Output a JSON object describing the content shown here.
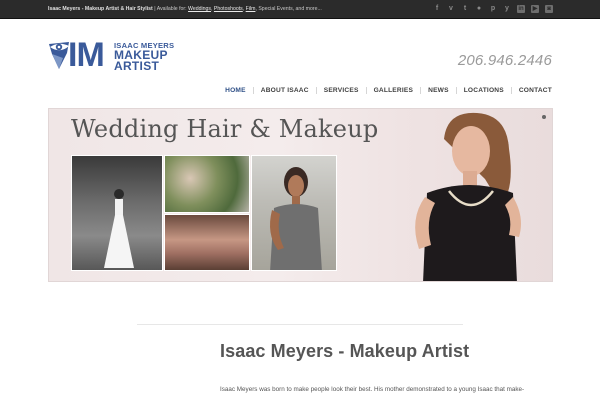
{
  "topbar": {
    "site_name": "Isaac Meyers - Makeup Artist & Hair Stylist",
    "available_text": " | Available for: ",
    "links": [
      "Weddings",
      "Photoshoots",
      "Film"
    ],
    "tail_text": " Special Events, and more...",
    "social_icons": [
      "facebook-icon",
      "vimeo-icon",
      "tumblr-icon",
      "flickr-icon",
      "pinterest-icon",
      "twitter-icon",
      "linkedin-icon",
      "youtube-icon",
      "instagram-icon"
    ]
  },
  "logo": {
    "initials": "IM",
    "name": "ISAAC MEYERS",
    "word1": "MAKEUP",
    "word2": "ARTIST",
    "color": "#3a5a9a"
  },
  "phone": "206.946.2446",
  "nav": {
    "items": [
      "HOME",
      "ABOUT ISAAC",
      "SERVICES",
      "GALLERIES",
      "NEWS",
      "LOCATIONS",
      "CONTACT"
    ],
    "active_index": 0,
    "active_color": "#2e4f86"
  },
  "slider": {
    "title": "Wedding Hair & Makeup"
  },
  "main": {
    "title": "Isaac Meyers - Makeup Artist",
    "intro": "Isaac Meyers was born to make people look their best. His mother demonstrated to a young Isaac that make-"
  }
}
